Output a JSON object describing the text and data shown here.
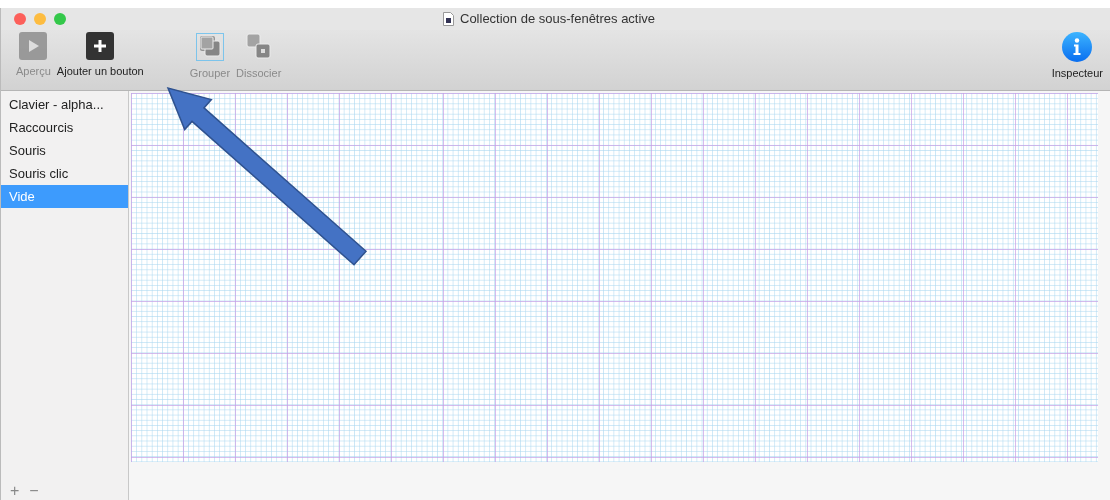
{
  "window": {
    "title": "Collection de sous-fenêtres active"
  },
  "toolbar": {
    "items": [
      {
        "kind": "preview",
        "label": "Aperçu",
        "disabled": true
      },
      {
        "kind": "add",
        "label": "Ajouter un bouton",
        "disabled": false
      },
      {
        "kind": "group",
        "label": "Grouper",
        "disabled": true
      },
      {
        "kind": "ungroup",
        "label": "Dissocier",
        "disabled": true
      }
    ],
    "inspector": {
      "label": "Inspecteur"
    }
  },
  "sidebar": {
    "items": [
      {
        "label": "Clavier - alpha...",
        "selected": false
      },
      {
        "label": "Raccourcis",
        "selected": false
      },
      {
        "label": "Souris",
        "selected": false
      },
      {
        "label": "Souris clic",
        "selected": false
      },
      {
        "label": "Vide",
        "selected": true
      }
    ],
    "add_button": "+",
    "remove_button": "−"
  }
}
